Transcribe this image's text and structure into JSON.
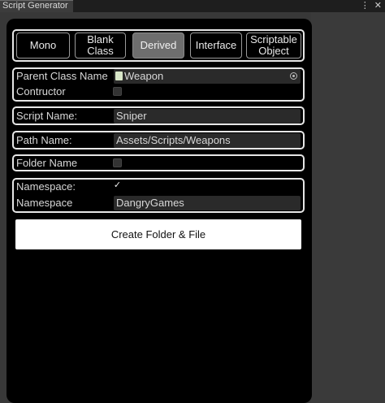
{
  "window": {
    "tab_title": "Script Generator",
    "menu_glyph": "⋮",
    "close_glyph": "✕"
  },
  "script_types": [
    {
      "label": "Mono",
      "active": false
    },
    {
      "label": "Blank\nClass",
      "active": false
    },
    {
      "label": "Derived",
      "active": true
    },
    {
      "label": "Interface",
      "active": false
    },
    {
      "label": "Scriptable\nObject",
      "active": false
    }
  ],
  "parent": {
    "class_label": "Parent Class Name",
    "class_value": "Weapon",
    "class_icon": "script-asset-icon",
    "picker_icon": "object-picker-icon",
    "constructor_label": "Contructor",
    "constructor_checked": false
  },
  "script_name": {
    "label": "Script Name:",
    "value": "Sniper"
  },
  "path_name": {
    "label": "Path Name:",
    "value": "Assets/Scripts/Weapons"
  },
  "folder_name": {
    "label": "Folder Name",
    "checked": false
  },
  "namespace": {
    "toggle_label": "Namespace:",
    "toggle_checked": true,
    "name_label": "Namespace",
    "name_value": "DangryGames"
  },
  "actions": {
    "create_label": "Create Folder & File"
  },
  "colors": {
    "panel": "#000000",
    "editor_bg": "#383838",
    "button_active": "#6e6e6e",
    "accent_white": "#ffffff"
  }
}
